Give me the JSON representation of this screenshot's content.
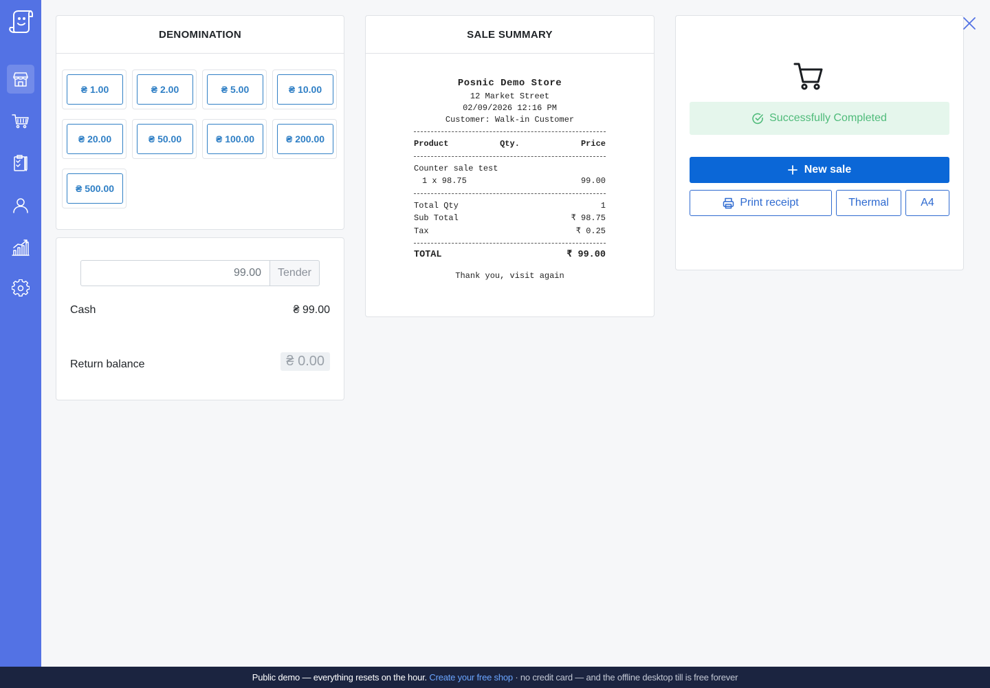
{
  "sidebar": {
    "logo_icon": "receipt-face-icon",
    "items": [
      {
        "name": "store-icon",
        "active": true
      },
      {
        "name": "cart-icon",
        "active": false
      },
      {
        "name": "clipboard-icon",
        "active": false
      },
      {
        "name": "user-icon",
        "active": false
      },
      {
        "name": "analytics-icon",
        "active": false
      },
      {
        "name": "settings-icon",
        "active": false
      }
    ]
  },
  "denomination": {
    "title": "DENOMINATION",
    "buttons": [
      "₴ 1.00",
      "₴ 2.00",
      "₴ 5.00",
      "₴ 10.00",
      "₴ 20.00",
      "₴ 50.00",
      "₴ 100.00",
      "₴ 200.00",
      "₴ 500.00"
    ]
  },
  "payment": {
    "tender_value": "99.00",
    "tender_label": "Tender",
    "cash_label": "Cash",
    "cash_value": "₴ 99.00",
    "return_label": "Return balance",
    "return_value": "₴ 0.00"
  },
  "summary": {
    "title": "SALE SUMMARY",
    "store_name": "Posnic Demo Store",
    "address": "12 Market Street",
    "datetime": "02/09/2026 12:16 PM",
    "customer": "Customer: Walk-in Customer",
    "col_product": "Product",
    "col_qty": "Qty.",
    "col_price": "Price",
    "item_name": "Counter sale test",
    "item_qty_line": "1 x 98.75",
    "item_price": "99.00",
    "total_qty_label": "Total Qty",
    "total_qty_value": "1",
    "subtotal_label": "Sub Total",
    "subtotal_value": "₹ 98.75",
    "tax_label": "Tax",
    "tax_value": "₹ 0.25",
    "total_label": "TOTAL",
    "total_value": "₹ 99.00",
    "thanks": "Thank you, visit again"
  },
  "completion": {
    "status": "Successfully Completed",
    "new_sale_label": "New sale",
    "print_receipt_label": "Print receipt",
    "thermal_label": "Thermal",
    "a4_label": "A4"
  },
  "footer": {
    "lead": "Public demo — everything resets on the hour.",
    "link": "Create your free shop",
    "tail": "· no credit card — and the offline desktop till is free forever"
  },
  "colors": {
    "sidebar": "#5372e4",
    "primary": "#0b67d7",
    "success": "#4fbb7a",
    "denom_accent": "#2f7fc5",
    "footer_bg": "#1b2440"
  }
}
